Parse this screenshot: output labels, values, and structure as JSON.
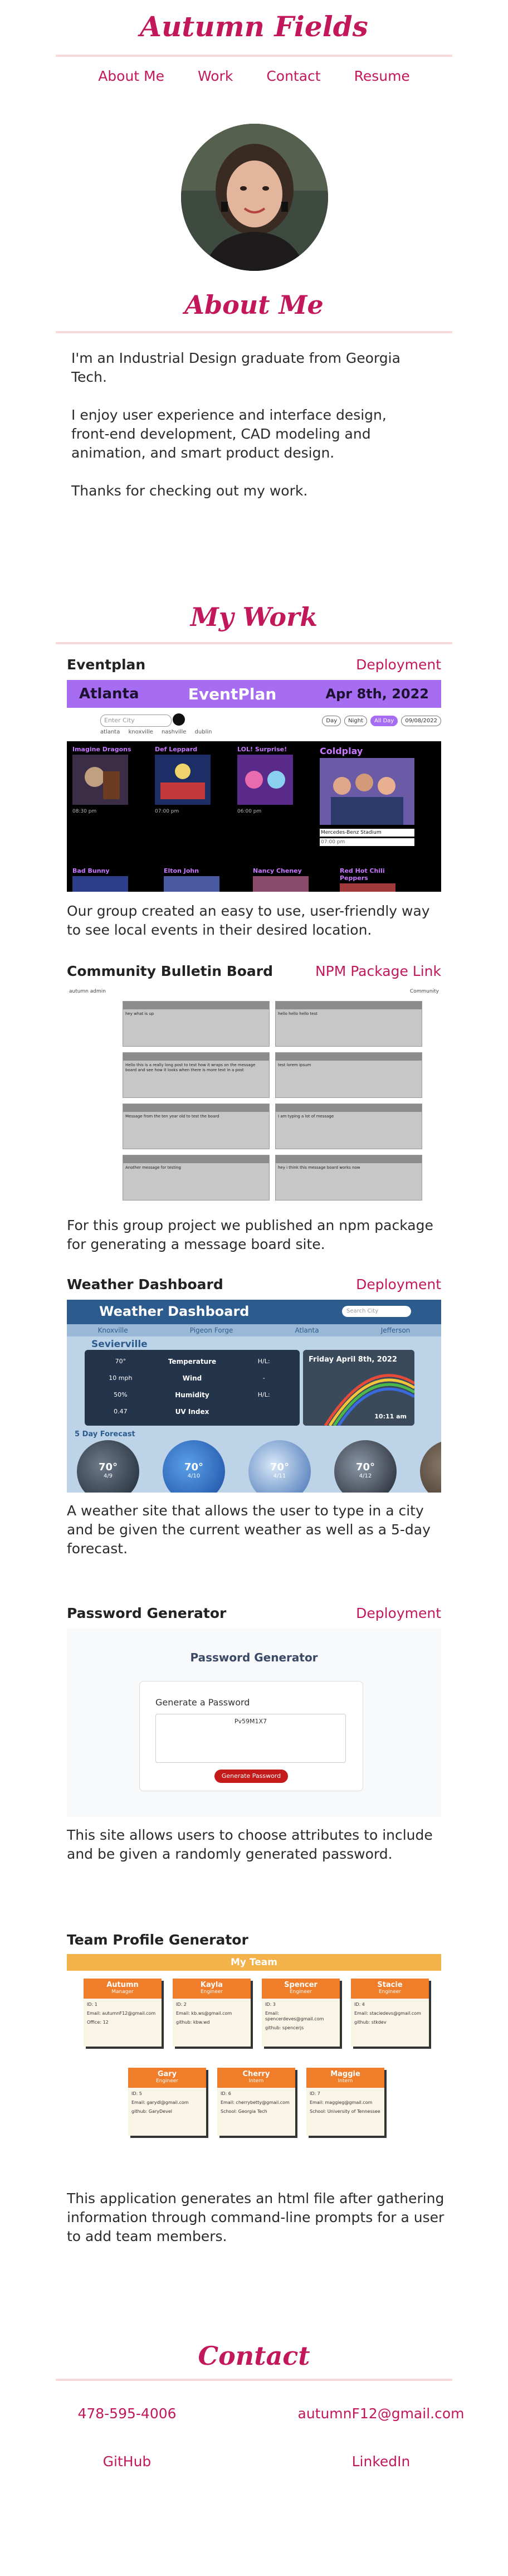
{
  "header": {
    "title": "Autumn Fields"
  },
  "nav": [
    {
      "label": "About Me"
    },
    {
      "label": "Work"
    },
    {
      "label": "Contact"
    },
    {
      "label": "Resume"
    }
  ],
  "about": {
    "heading": "About Me",
    "paragraphs": [
      "I'm an Industrial Design graduate from Georgia Tech.",
      "I enjoy user experience and interface design, front-end development, CAD modeling and animation, and smart product design.",
      "Thanks for checking out my work."
    ]
  },
  "work": {
    "heading": "My Work",
    "projects": [
      {
        "title": "Eventplan",
        "link": "Deployment",
        "description": "Our group created an easy to use, user-friendly way to see local events in their desired location.",
        "screenshot": {
          "city": "Atlanta",
          "app_name": "EventPlan",
          "date": "Apr 8th, 2022",
          "search_placeholder": "Enter City",
          "cities": "atlanta knoxville nashville dublin",
          "chips": [
            "Day",
            "Night",
            "All Day",
            "09/08/2022"
          ],
          "events": [
            {
              "name": "Imagine Dragons",
              "time": "08:30 pm"
            },
            {
              "name": "Def Leppard",
              "time": "07:00 pm"
            },
            {
              "name": "LOL! Surprise!",
              "time": "06:00 pm"
            },
            {
              "name": "Coldplay",
              "venue": "Mercedes-Benz Stadium",
              "time": "07:00 pm"
            },
            {
              "name": "Bad Bunny",
              "time": ""
            },
            {
              "name": "Elton John",
              "time": ""
            },
            {
              "name": "Nancy Cheney",
              "time": ""
            },
            {
              "name": "Red Hot Chili Peppers",
              "time": ""
            }
          ]
        }
      },
      {
        "title": "Community Bulletin Board",
        "link": "NPM Package Link",
        "description": "For this group project we published an npm package for generating a message board site.",
        "screenshot": {
          "top_left": "autumn   admin",
          "top_right": "Community",
          "posts": [
            "hey what is up",
            "hello hello hello test",
            "Hello this is a really long post to test how it wraps on the message board and see how it looks when there is more text in a post",
            "test lorem ipsum",
            "Message from the ten year old to test the board",
            "I am typing a lot of message",
            "Another message for testing",
            "hey i think this message board works now"
          ]
        }
      },
      {
        "title": "Weather Dashboard",
        "link": "Deployment",
        "description": "A weather site that allows the user to type in a city and be given the current weather as well as a 5-day forecast.",
        "screenshot": {
          "app_name": "Weather Dashboard",
          "search_placeholder": "Search City",
          "tabs": [
            "Knoxville",
            "Pigeon Forge",
            "Atlanta",
            "Jefferson"
          ],
          "city": "Sevierville",
          "rows": [
            {
              "value": "70°",
              "label": "Temperature",
              "extra": "H/L:"
            },
            {
              "value": "10 mph",
              "label": "Wind",
              "extra": "-"
            },
            {
              "value": "50%",
              "label": "Humidity",
              "extra": "H/L:"
            },
            {
              "value": "0.47",
              "label": "UV Index",
              "extra": ""
            }
          ],
          "date": "Friday April 8th, 2022",
          "time": "10:11 am",
          "forecast_label": "5 Day Forecast",
          "forecast": [
            {
              "temp": "70°",
              "day": "4/9"
            },
            {
              "temp": "70°",
              "day": "4/10"
            },
            {
              "temp": "70°",
              "day": "4/11"
            },
            {
              "temp": "70°",
              "day": "4/12"
            }
          ]
        }
      },
      {
        "title": "Password Generator",
        "link": "Deployment",
        "description": "This site allows users to choose attributes to include and be given a randomly generated password.",
        "screenshot": {
          "app_name": "Password Generator",
          "card_label": "Generate a Password",
          "password": "Pv59M1X7",
          "button": "Generate Password"
        }
      },
      {
        "title": "Team Profile Generator",
        "link": "",
        "description": "This application generates an html file after gathering information through command-line prompts for a user to add team members.",
        "screenshot": {
          "header": "My Team",
          "members": [
            {
              "name": "Autumn",
              "role": "Manager",
              "id": "ID: 1",
              "email": "Email: autumnF12@gmail.com",
              "extra": "Office: 12"
            },
            {
              "name": "Kayla",
              "role": "Engineer",
              "id": "ID: 2",
              "email": "Email: kb.ws@gmail.com",
              "extra": "github: kbw.wd"
            },
            {
              "name": "Spencer",
              "role": "Engineer",
              "id": "ID: 3",
              "email": "Email: spencerdeves@gmail.com",
              "extra": "github: spencerjs"
            },
            {
              "name": "Stacie",
              "role": "Engineer",
              "id": "ID: 4",
              "email": "Email: staciedevs@gmail.com",
              "extra": "github: stkdev"
            },
            {
              "name": "Gary",
              "role": "Engineer",
              "id": "ID: 5",
              "email": "Email: garydl@gmail.com",
              "extra": "github: GaryDevel"
            },
            {
              "name": "Cherry",
              "role": "Intern",
              "id": "ID: 6",
              "email": "Email: cherrybetty@gmail.com",
              "extra": "School: Georgia Tech"
            },
            {
              "name": "Maggie",
              "role": "Intern",
              "id": "ID: 7",
              "email": "Email: maggieg@gmail.com",
              "extra": "School: University of Tennessee"
            }
          ]
        }
      }
    ]
  },
  "contact": {
    "heading": "Contact",
    "phone": "478-595-4006",
    "email": "autumnF12@gmail.com",
    "github": "GitHub",
    "linkedin": "LinkedIn"
  }
}
